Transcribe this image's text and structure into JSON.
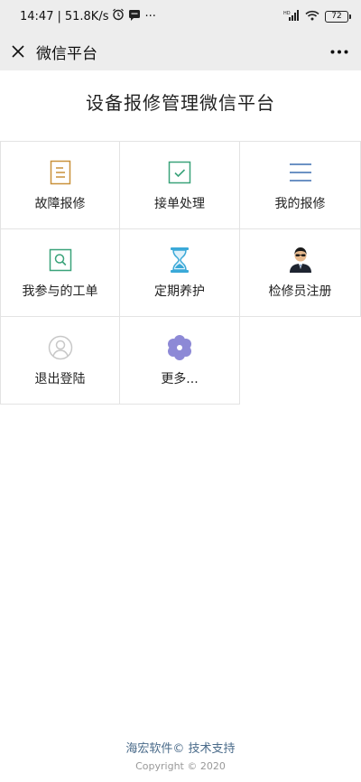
{
  "status_bar": {
    "time": "14:47",
    "net_speed": "51.8K/s",
    "more": "···",
    "network": "HD",
    "battery": "72"
  },
  "navbar": {
    "title": "微信平台",
    "more": "•••"
  },
  "page": {
    "title": "设备报修管理微信平台"
  },
  "menu": {
    "items": [
      {
        "label": "故障报修",
        "icon": "document-icon",
        "color": "#c9913a"
      },
      {
        "label": "接单处理",
        "icon": "checkbox-icon",
        "color": "#3aa37a"
      },
      {
        "label": "我的报修",
        "icon": "list-icon",
        "color": "#3b6fb0"
      },
      {
        "label": "我参与的工单",
        "icon": "search-box-icon",
        "color": "#3aa37a"
      },
      {
        "label": "定期养护",
        "icon": "hourglass-icon",
        "color": "#3aa9d8"
      },
      {
        "label": "检修员注册",
        "icon": "person-avatar-icon",
        "color": "#333333"
      },
      {
        "label": "退出登陆",
        "icon": "user-outline-icon",
        "color": "#c8c8c8"
      },
      {
        "label": "更多...",
        "icon": "flower-icon",
        "color": "#8d89d6"
      }
    ]
  },
  "footer": {
    "support": "海宏软件© 技术支持",
    "copyright": "Copyright © 2020"
  }
}
